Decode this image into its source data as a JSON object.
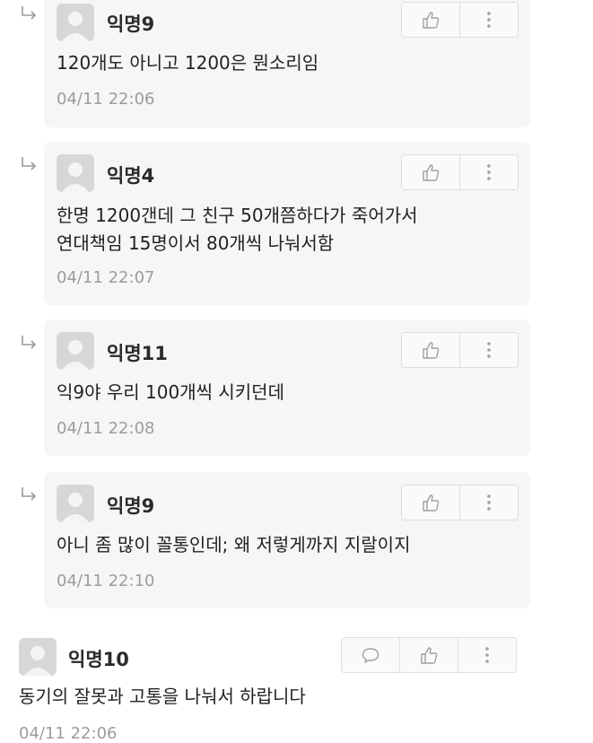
{
  "replies": [
    {
      "author": "익명9",
      "text": "120개도 아니고 1200은 뭔소리임",
      "time": "04/11 22:06"
    },
    {
      "author": "익명4",
      "text": "한명 1200갠데 그 친구 50개쯤하다가 죽어가서\n연대책임 15명이서 80개씩 나눠서함",
      "time": "04/11 22:07"
    },
    {
      "author": "익명11",
      "text": "익9야 우리 100개씩 시키던데",
      "time": "04/11 22:08"
    },
    {
      "author": "익명9",
      "text": "아니 좀 많이 꼴통인데; 왜 저렇게까지 지랄이지",
      "time": "04/11 22:10"
    }
  ],
  "comment": {
    "author": "익명10",
    "text": "동기의 잘못과 고통을 나눠서 하랍니다",
    "time": "04/11 22:06"
  },
  "icons": {
    "reply_arrow": "reply-arrow-icon",
    "avatar": "default-avatar-icon",
    "like": "thumbs-up-icon",
    "more": "more-vertical-icon",
    "reply": "speech-bubble-icon"
  },
  "colors": {
    "card_bg": "#f6f6f6",
    "time_text": "#9c9c9c",
    "icon": "#a0a0a0"
  }
}
